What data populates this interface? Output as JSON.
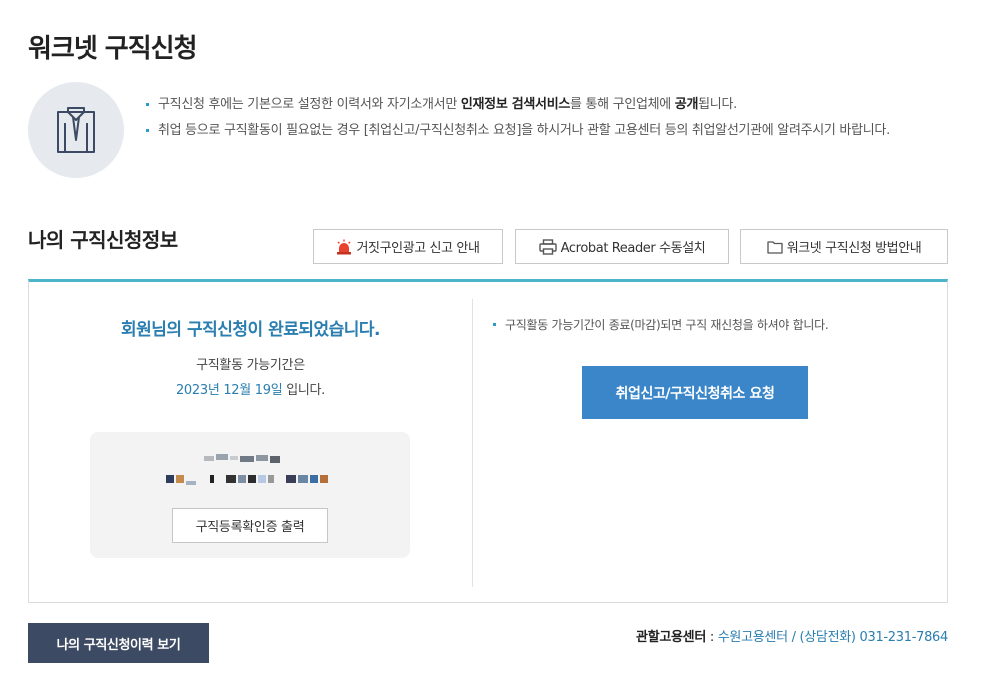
{
  "page": {
    "title": "워크넷 구직신청"
  },
  "intro": {
    "line1_before": "구직신청 후에는 기본으로 설정한 이력서와 자기소개서만 ",
    "line1_strong1": "인재정보 검색서비스",
    "line1_middle": "를 통해 구인업체에 ",
    "line1_strong2": "공개",
    "line1_after": "됩니다.",
    "line2": "취업 등으로 구직활동이 필요없는 경우 [취업신고/구직신청취소 요청]을 하시거나 관할 고용센터 등의 취업알선기관에 알려주시기 바랍니다."
  },
  "section": {
    "title": "나의 구직신청정보"
  },
  "buttons": {
    "report": "거짓구인광고 신고 안내",
    "acrobat": "Acrobat Reader 수동설치",
    "guide": "워크넷 구직신청 방법안내"
  },
  "status": {
    "complete_message": "회원님의 구직신청이 완료되었습니다.",
    "period_label": "구직활동 가능기간은",
    "period_date": "2023년 12월 19일",
    "period_suffix": " 입니다.",
    "cert_button": "구직등록확인증 출력"
  },
  "reapply": {
    "note": "구직활동 가능기간이 종료(마감)되면 구직 재신청을 하셔야 합니다.",
    "cancel_button": "취업신고/구직신청취소 요청"
  },
  "footer": {
    "history_button": "나의 구직신청이력 보기",
    "center_label": "관할고용센터",
    "center_colon": " : ",
    "center_name": "수원고용센터",
    "center_sep": " / ",
    "phone_label": "(상담전화)",
    "phone_number": " 031-231-7864"
  },
  "colors": {
    "accent": "#2a7eb0",
    "primary_button": "#3a86c8",
    "dark_button": "#3d4a63",
    "box_top_border": "#4db5c9"
  },
  "icons": [
    "shirt-icon",
    "siren-icon",
    "printer-icon",
    "folder-icon"
  ]
}
